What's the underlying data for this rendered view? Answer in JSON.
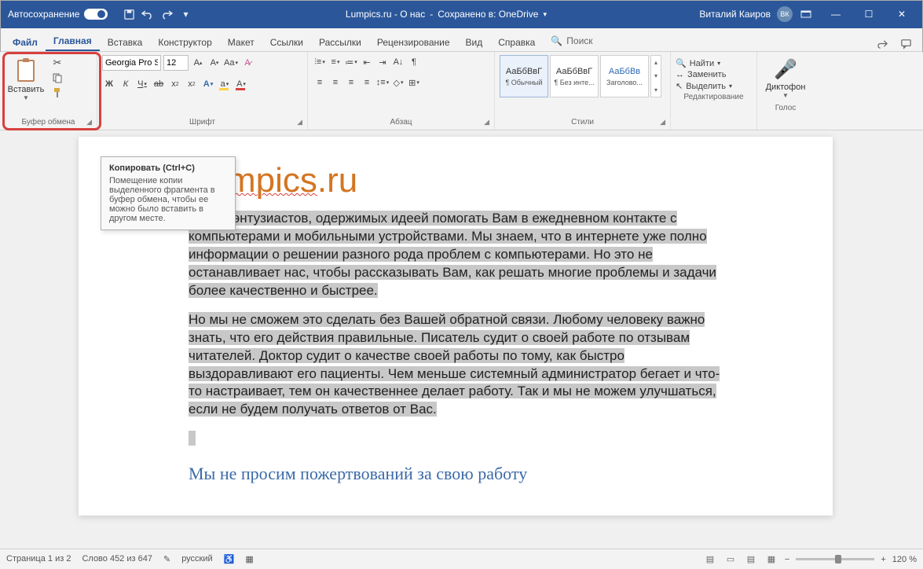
{
  "titlebar": {
    "autosave": "Автосохранение",
    "doc_title": "Lumpics.ru - О нас",
    "saved_in": "Сохранено в: OneDrive",
    "user": "Виталий Каиров",
    "initials": "ВК"
  },
  "tabs": {
    "file": "Файл",
    "home": "Главная",
    "insert": "Вставка",
    "design": "Конструктор",
    "layout": "Макет",
    "references": "Ссылки",
    "mailings": "Рассылки",
    "review": "Рецензирование",
    "view": "Вид",
    "help": "Справка",
    "search": "Поиск"
  },
  "ribbon": {
    "clipboard": {
      "paste": "Вставить",
      "group": "Буфер обмена"
    },
    "font": {
      "name": "Georgia Pro S",
      "size": "12",
      "group": "Шрифт",
      "bold": "Ж",
      "italic": "К",
      "underline": "Ч"
    },
    "paragraph": {
      "group": "Абзац"
    },
    "styles": {
      "group": "Стили",
      "preview": "АаБбВвГ",
      "normal": "¶ Обычный",
      "nospacing": "¶ Без инте...",
      "heading1": "Заголово...",
      "preview_blue": "АаБбВв"
    },
    "editing": {
      "group": "Редактирование",
      "find": "Найти",
      "replace": "Заменить",
      "select": "Выделить"
    },
    "voice": {
      "group": "Голос",
      "dictate": "Диктофон"
    }
  },
  "tooltip": {
    "title": "Копировать (Ctrl+C)",
    "body": "Помещение копии выделенного фрагмента в буфер обмена, чтобы ее можно было вставить в другом месте."
  },
  "document": {
    "title_a": "Lumpics",
    "title_b": ".ru",
    "p1_pre": "группа энтузиастов, одержимых идеей помогать Вам в ежедневном контакте с компьютерами и мобильными устройствами. Мы знаем, что в интернете уже полно информации о решении разного рода проблем с компьютерами. Но это не останавливает нас, чтобы рассказывать Вам, как решать многие проблемы и задачи более качественно и быстрее.",
    "p2": "Но мы не сможем это сделать без Вашей обратной связи. Любому человеку важно знать, что его действия правильные. Писатель судит о своей работе по отзывам читателей. Доктор судит о качестве своей работы по тому, как быстро выздоравливают его пациенты. Чем меньше системный администратор бегает и что-то настраивает, тем он качественнее делает работу. Так и мы не можем улучшаться, если не будем получать ответов от Вас.",
    "h2": "Мы не просим пожертвований за свою работу"
  },
  "statusbar": {
    "page": "Страница 1 из 2",
    "words": "Слово 452 из 647",
    "lang": "русский",
    "zoom": "120 %"
  }
}
